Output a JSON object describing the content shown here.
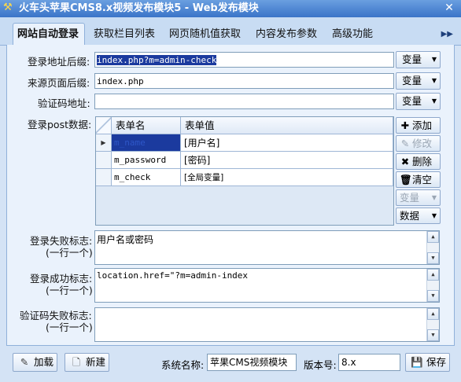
{
  "window": {
    "title": "火车头苹果CMS8.x视频发布模块5 - Web发布模块",
    "app_icon": "hammer-pick-icon",
    "close_icon": "close-icon"
  },
  "tabs": {
    "items": [
      {
        "label": "网站自动登录",
        "active": true
      },
      {
        "label": "获取栏目列表"
      },
      {
        "label": "网页随机值获取"
      },
      {
        "label": "内容发布参数"
      },
      {
        "label": "高级功能"
      }
    ],
    "more_icon": "double-chevron-right-icon"
  },
  "login": {
    "url_suffix_label": "登录地址后缀:",
    "url_suffix_value": "index.php?m=admin-check",
    "referer_suffix_label": "来源页面后缀:",
    "referer_suffix_value": "index.php",
    "captcha_url_label": "验证码地址:",
    "captcha_url_value": "",
    "variable_button_label": "变量",
    "post_data_label": "登录post数据:"
  },
  "post_grid": {
    "headers": [
      "表单名",
      "表单值"
    ],
    "rows": [
      {
        "name": "m_name",
        "value": "[用户名]",
        "selected": true
      },
      {
        "name": "m_password",
        "value": "[密码]"
      },
      {
        "name": "m_check",
        "value": "[全局变量]"
      }
    ]
  },
  "grid_actions": {
    "add": "添加",
    "edit": "修改",
    "delete": "删除",
    "clear": "清空",
    "variable": "变量",
    "data": "数据"
  },
  "flags": {
    "fail_label": "登录失败标志:",
    "fail_hint": "(一行一个)",
    "fail_value": "用户名或密码",
    "success_label": "登录成功标志:",
    "success_hint": "(一行一个)",
    "success_value": "location.href=\"?m=admin-index",
    "captcha_fail_label": "验证码失败标志:",
    "captcha_fail_hint": "(一行一个)",
    "captcha_fail_value": ""
  },
  "footer": {
    "load_label": "加载",
    "new_label": "新建",
    "system_name_label": "系统名称:",
    "system_name_value": "苹果CMS视频模块",
    "version_label": "版本号:",
    "version_value": "8.x",
    "save_label": "保存"
  },
  "colors": {
    "selection": "#1b3a9e",
    "title_bar": "#3a74c8",
    "panel": "#eaf2fc"
  }
}
